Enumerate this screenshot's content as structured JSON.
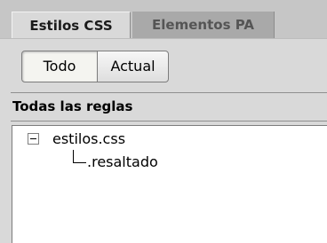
{
  "tabs": [
    {
      "label": "Estilos CSS",
      "active": true
    },
    {
      "label": "Elementos PA",
      "active": false
    }
  ],
  "filter": {
    "options": [
      "Todo",
      "Actual"
    ],
    "selected": "Todo"
  },
  "section": {
    "title": "Todas las reglas"
  },
  "tree": {
    "file": "estilos.css",
    "expanded": true,
    "rules": [
      ".resaltado"
    ]
  },
  "icons": {
    "expander": "minus-box-icon",
    "connector": "tree-connector-icon"
  },
  "colors": {
    "panel_bg": "#d9d9d9",
    "tabbar_bg": "#c6c6c6",
    "inactive_tab_bg": "#a9a9a9",
    "tree_bg": "#ffffff"
  }
}
